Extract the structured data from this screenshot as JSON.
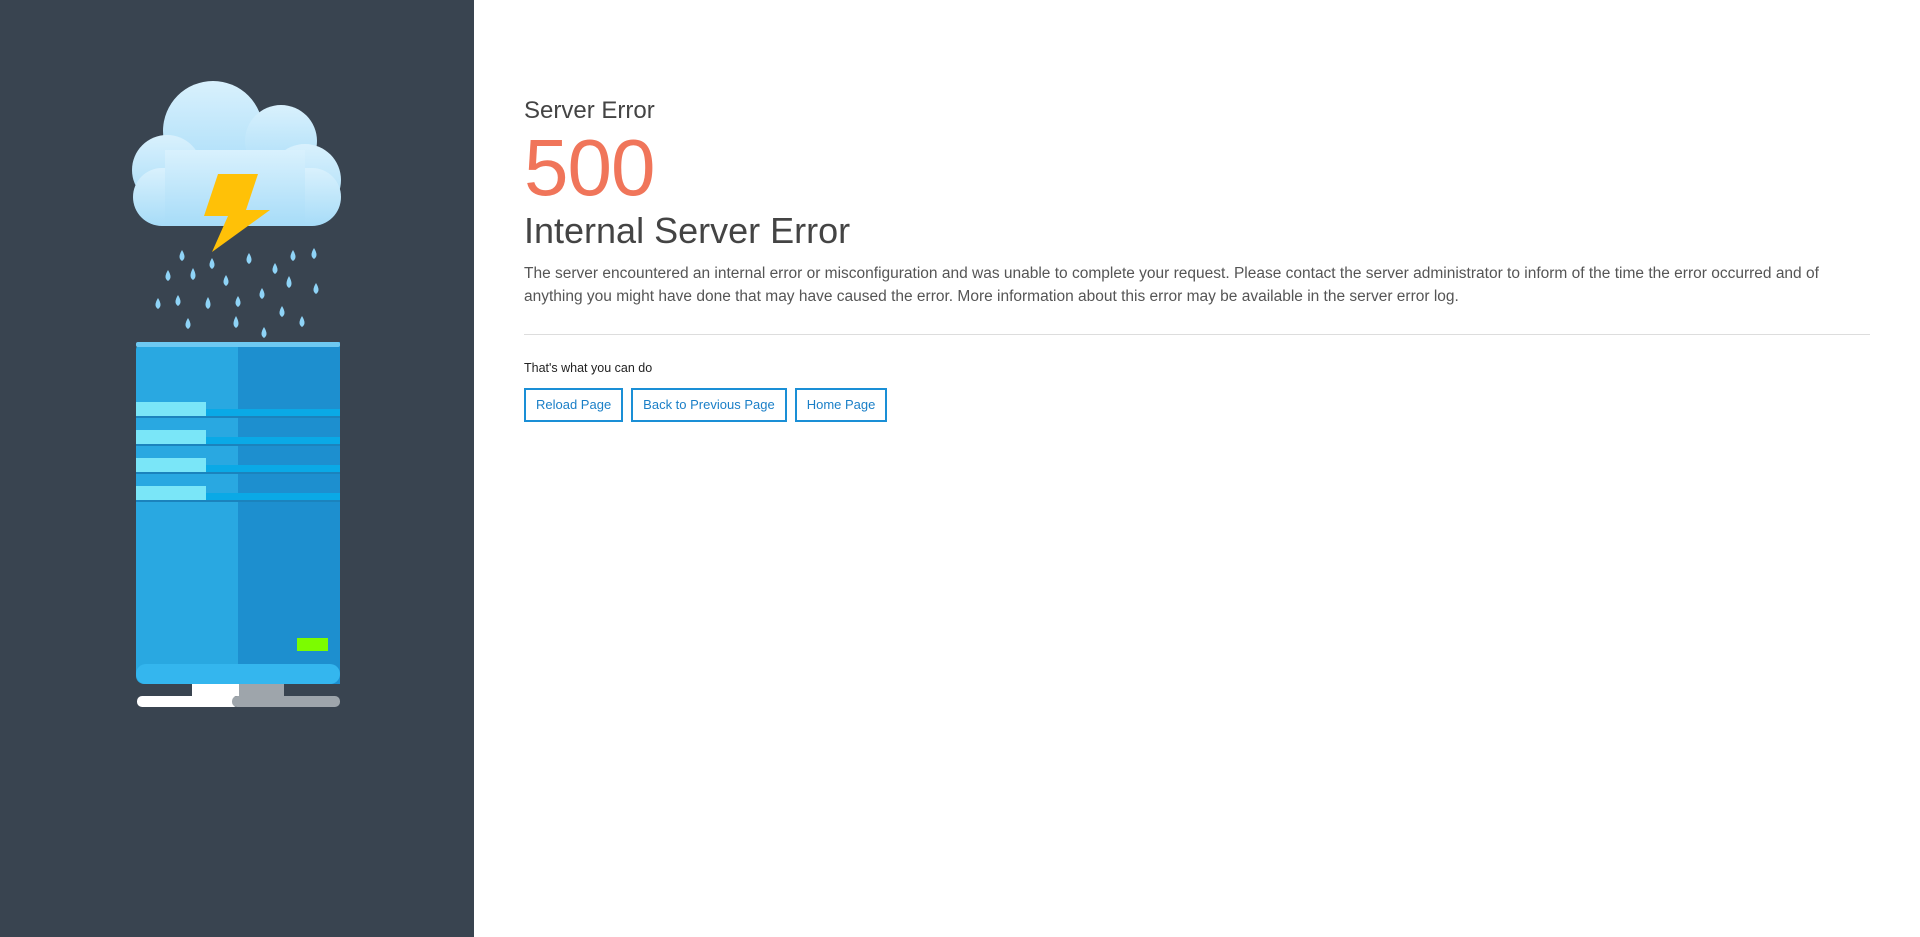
{
  "error": {
    "subtitle": "Server Error",
    "code": "500",
    "title": "Internal Server Error",
    "message": "The server encountered an internal error or misconfiguration and was unable to complete your request. Please contact the server administrator to inform of the time the error occurred and of anything you might have done that may have caused the error. More information about this error may be available in the server error log."
  },
  "actions": {
    "heading": "That's what you can do",
    "reload_label": "Reload Page",
    "back_label": "Back to Previous Page",
    "home_label": "Home Page"
  },
  "illustration": {
    "icon": "server-storm-icon",
    "colors": {
      "sidebar": "#394450",
      "cloud": "#bfe6fb",
      "lightning": "#ffc107",
      "raindrop": "#8fd4f7",
      "server_light": "#29a8e1",
      "server_dark": "#1d8fcf",
      "status_led": "#7cfc00",
      "accent": "#f0755a",
      "button_border": "#1a8fd6"
    }
  }
}
